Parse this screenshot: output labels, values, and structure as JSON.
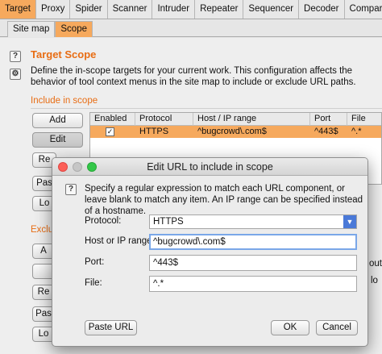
{
  "tabs": [
    "Target",
    "Proxy",
    "Spider",
    "Scanner",
    "Intruder",
    "Repeater",
    "Sequencer",
    "Decoder",
    "Comparer"
  ],
  "subtabs": [
    "Site map",
    "Scope"
  ],
  "scope": {
    "title": "Target Scope",
    "description": "Define the in-scope targets for your current work. This configuration affects the behavior of tool context menus in the site map to include or exclude URL paths.",
    "include_label": "Include in scope",
    "exclude_label": "Exclu"
  },
  "include_buttons": {
    "add": "Add",
    "edit": "Edit",
    "remove": "Re",
    "paste": "Pas",
    "load": "Lo"
  },
  "exclude_buttons": {
    "add": "A",
    "edit": "",
    "remove": "Re",
    "paste": "Pas",
    "load": "Lo"
  },
  "include_table": {
    "columns": [
      "Enabled",
      "Protocol",
      "Host / IP range",
      "Port",
      "File"
    ],
    "rows": [
      {
        "enabled": "✓",
        "protocol": "HTTPS",
        "host": "^bugcrowd\\.com$",
        "port": "^443$",
        "file": "^.*"
      }
    ]
  },
  "exclude_table_fragment": {
    "line1": "out",
    "line2": "lo"
  },
  "dialog": {
    "title": "Edit URL to include in scope",
    "description": "Specify a regular expression to match each URL component, or leave blank to match any item. An IP range can be specified instead of a hostname.",
    "protocol_label": "Protocol:",
    "protocol_value": "HTTPS",
    "host_label": "Host or IP range:",
    "host_value": "^bugcrowd\\.com$",
    "port_label": "Port:",
    "port_value": "^443$",
    "file_label": "File:",
    "file_value": "^.*",
    "paste_url": "Paste URL",
    "ok": "OK",
    "cancel": "Cancel"
  },
  "colors": {
    "accent_orange": "#f6a95d",
    "heading_orange": "#e86d14"
  }
}
